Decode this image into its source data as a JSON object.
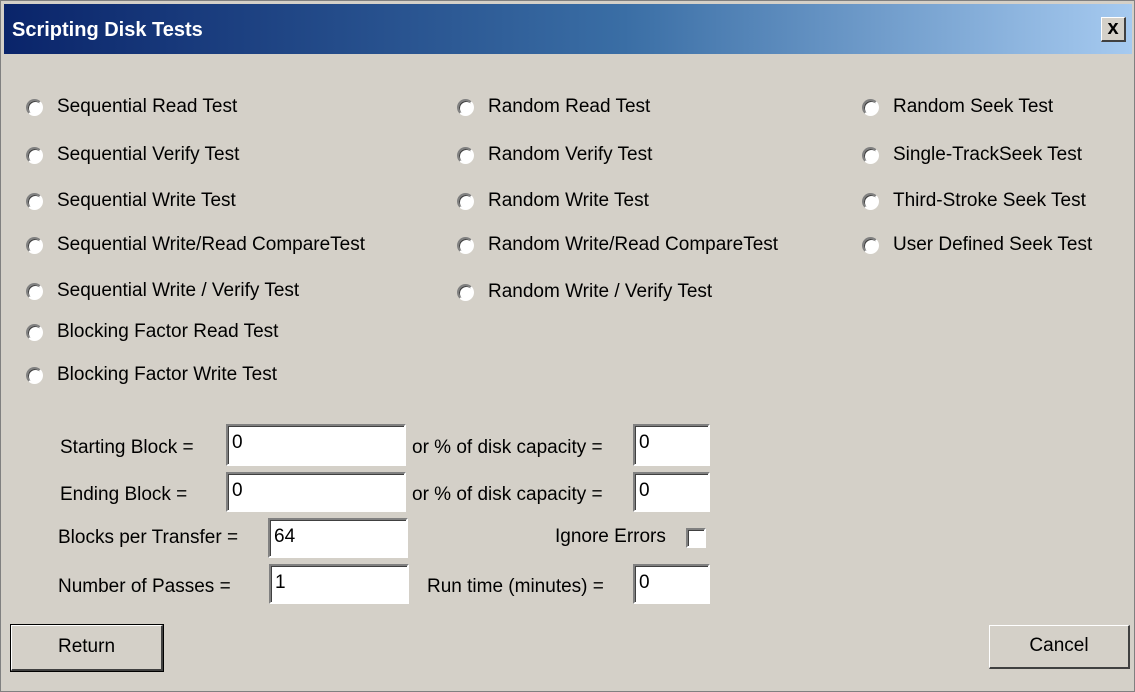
{
  "window": {
    "title": "Scripting Disk Tests",
    "close_label": "x"
  },
  "tests": {
    "col1": [
      "Sequential Read Test",
      "Sequential Verify Test",
      "Sequential Write Test",
      "Sequential Write/Read CompareTest",
      "Sequential Write / Verify Test",
      "Blocking Factor Read Test",
      "Blocking Factor Write Test"
    ],
    "col2": [
      "Random Read Test",
      "Random Verify Test",
      "Random Write Test",
      "Random Write/Read CompareTest",
      "Random Write / Verify Test"
    ],
    "col3": [
      "Random Seek Test",
      "Single-TrackSeek Test",
      "Third-Stroke Seek Test",
      "User Defined Seek Test"
    ]
  },
  "params": {
    "starting_block_label": "Starting Block =",
    "starting_block_value": "0",
    "starting_pct_label": "or % of disk capacity =",
    "starting_pct_value": "0",
    "ending_block_label": "Ending  Block =",
    "ending_block_value": "0",
    "ending_pct_label": "or % of disk capacity =",
    "ending_pct_value": "0",
    "blocks_per_transfer_label": "Blocks per Transfer =",
    "blocks_per_transfer_value": "64",
    "ignore_errors_label": "Ignore Errors",
    "num_passes_label": "Number of  Passes  =",
    "num_passes_value": "1",
    "run_time_label": "Run time (minutes) =",
    "run_time_value": "0"
  },
  "buttons": {
    "return_label": "Return",
    "cancel_label": "Cancel"
  }
}
